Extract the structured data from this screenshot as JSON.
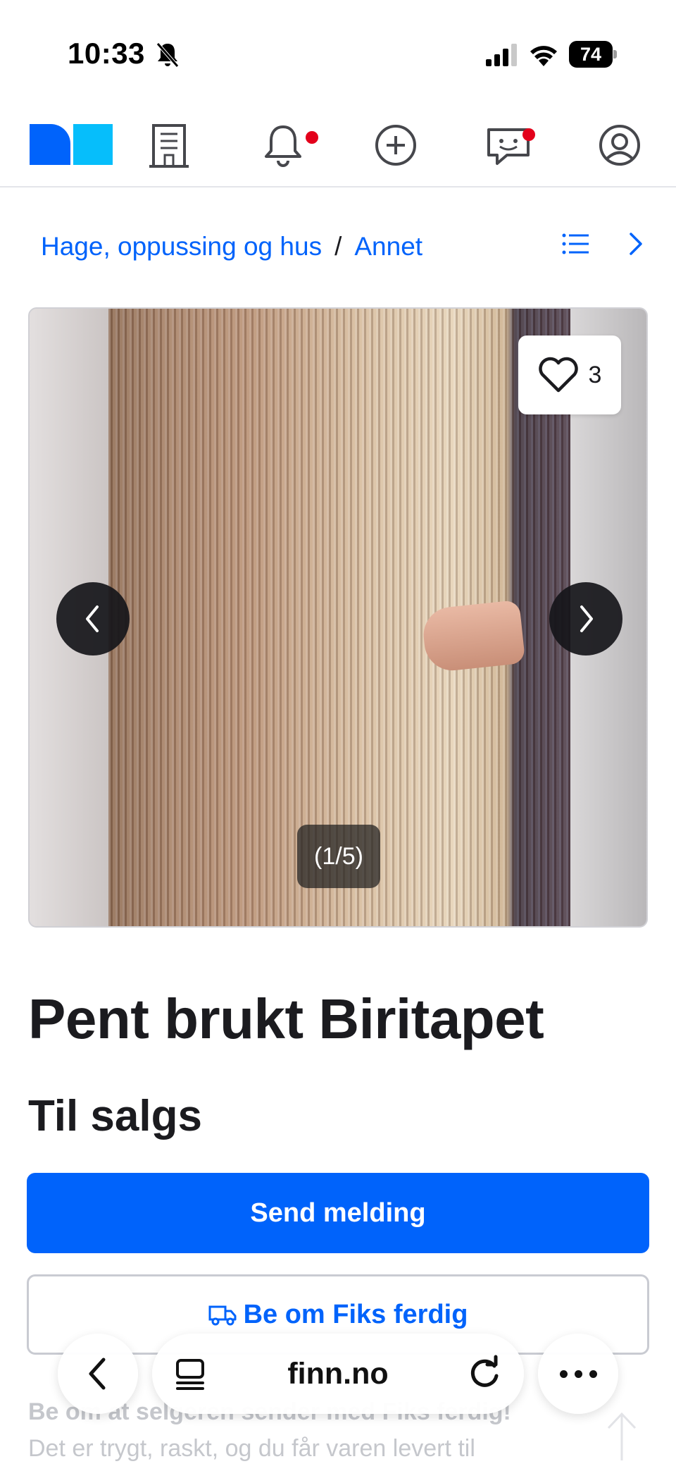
{
  "status_bar": {
    "time": "10:33",
    "battery": "74"
  },
  "breadcrumb": {
    "category": "Hage, oppussing og hus",
    "separator": "/",
    "subcategory": "Annet"
  },
  "gallery": {
    "favorite_count": "3",
    "counter": "(1/5)"
  },
  "listing": {
    "title": "Pent brukt Biritapet",
    "type": "Til salgs"
  },
  "actions": {
    "send_message": "Send melding",
    "fiks_ferdig": "Be om Fiks ferdig"
  },
  "promo": {
    "title": "Be om at selgeren sender med Fiks ferdig!",
    "text": "Det er trygt, raskt, og du får varen levert til"
  },
  "browser": {
    "url": "finn.no"
  },
  "colors": {
    "accent": "#0063fb",
    "notification": "#e3001b",
    "logo_dark": "#0063fb",
    "logo_light": "#06befb"
  }
}
